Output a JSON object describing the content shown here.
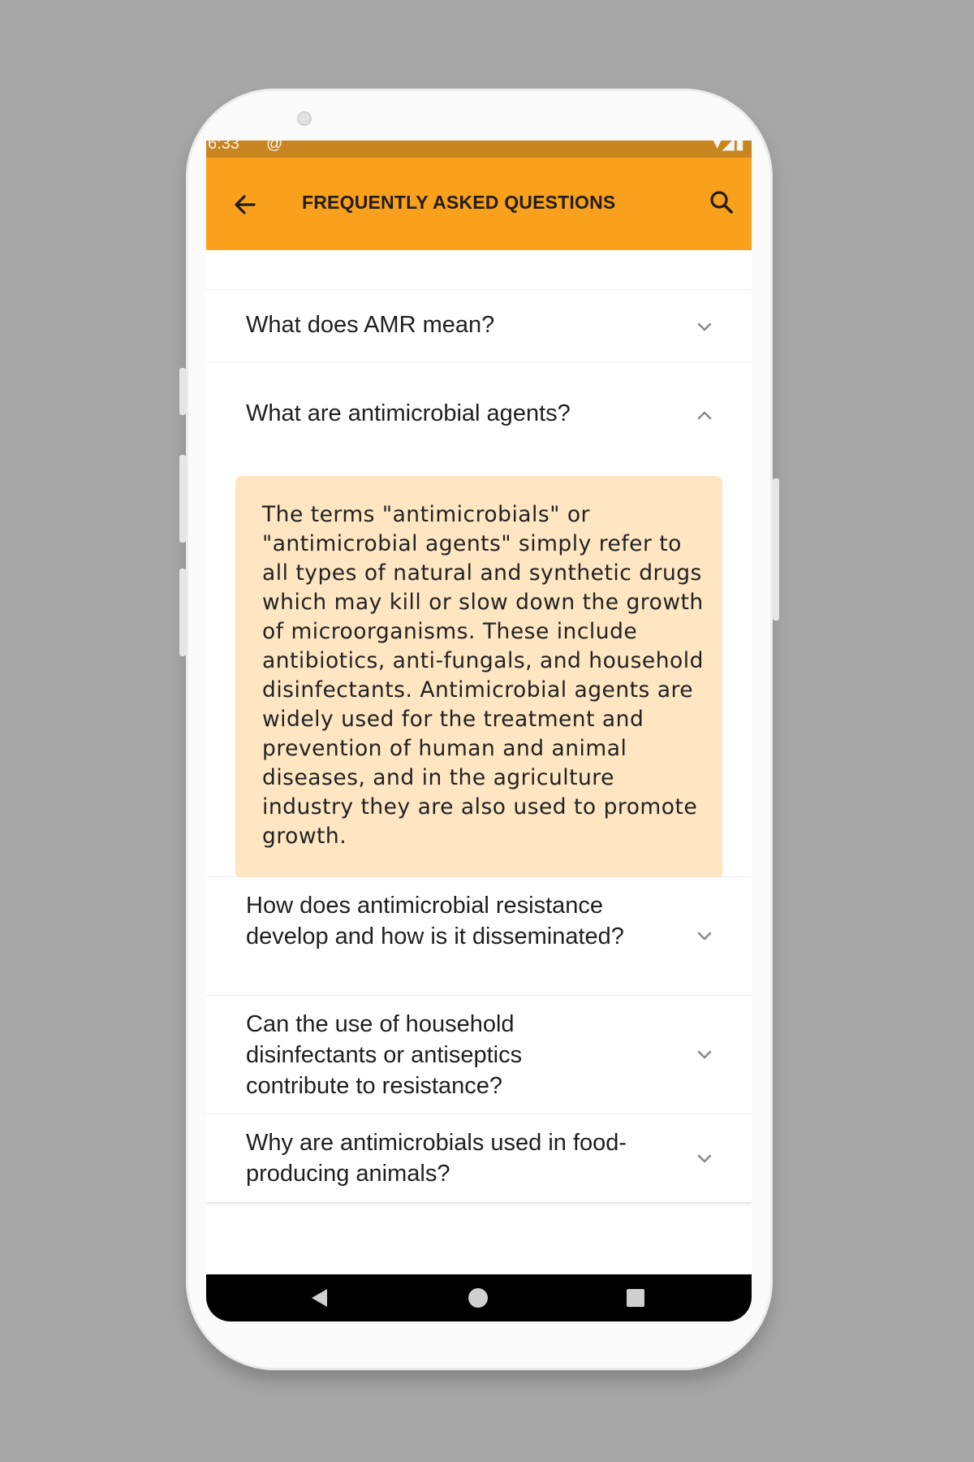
{
  "status_bar": {
    "time": "6:33",
    "extra_icon": "@",
    "icons": "▾◢▮"
  },
  "app_bar": {
    "title": "FREQUENTLY ASKED QUESTIONS",
    "back_icon": "arrow-left-icon",
    "search_icon": "search-icon"
  },
  "colors": {
    "app_bar": "#f9a11c",
    "status_bar": "#c98520",
    "answer_bg": "#ffe6c2"
  },
  "faq": {
    "items": [
      {
        "question": "What does AMR mean?",
        "expanded": false
      },
      {
        "question": "What are antimicrobial agents?",
        "expanded": true,
        "answer": "The terms \"antimicrobials\" or \"antimicrobial agents\" simply refer to all types of natural and synthetic drugs which may kill or slow down the growth of microorganisms. These include antibiotics, anti-fungals, and household disinfectants. Antimicrobial agents are widely used for the treatment and prevention of human and animal diseases, and in the agriculture industry they are also used to promote growth."
      },
      {
        "question": "How does antimicrobial resistance develop and how is it disseminated?",
        "expanded": false
      },
      {
        "question": "Can the use of household disinfectants or antiseptics contribute to resistance?",
        "expanded": false
      },
      {
        "question": "Why are antimicrobials used in food-producing animals?",
        "expanded": false
      }
    ]
  },
  "nav_bar": {
    "back_icon": "nav-back-icon",
    "home_icon": "nav-home-icon",
    "recents_icon": "nav-recents-icon"
  }
}
